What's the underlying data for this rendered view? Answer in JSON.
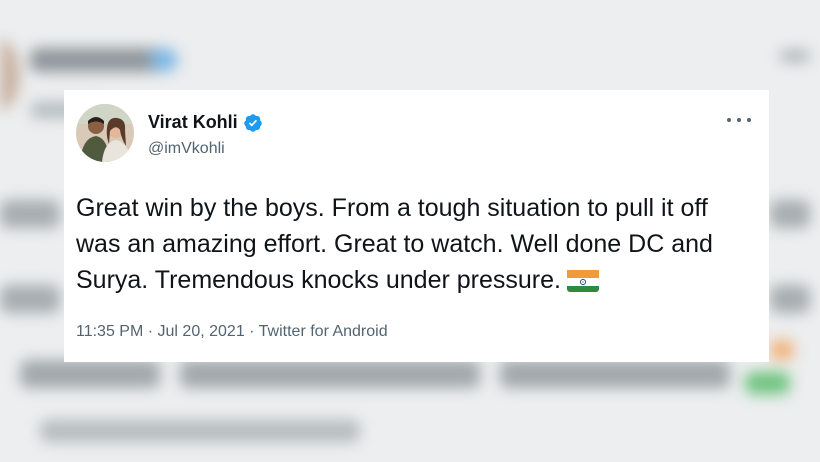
{
  "tweet": {
    "display_name": "Virat Kohli",
    "handle": "@imVkohli",
    "verified": true,
    "text": "Great win by the boys. From a tough situation to pull it off was an amazing effort. Great to watch. Well done DC and Surya. Tremendous knocks under pressure.",
    "emoji": "india-flag",
    "time": "11:35 PM",
    "separator_1": "·",
    "date": "Jul 20, 2021",
    "separator_2": "·",
    "source": "Twitter for Android"
  },
  "icons": {
    "verified": "verified-badge-icon",
    "more": "more-options-icon",
    "flag": "india-flag-icon"
  },
  "colors": {
    "verified_blue": "#1d9bf0",
    "text_primary": "#0f1419",
    "text_secondary": "#536471"
  }
}
